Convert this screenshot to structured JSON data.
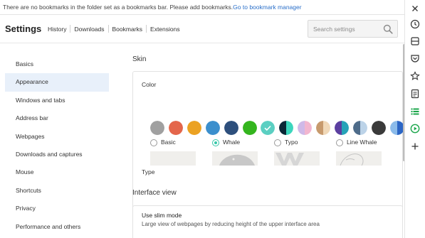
{
  "bookmark_bar": {
    "message": "There are no bookmarks in the folder set as a bookmarks bar. Please add bookmarks.",
    "link": "Go to bookmark manager"
  },
  "header": {
    "title": "Settings",
    "nav": [
      "History",
      "Downloads",
      "Bookmarks",
      "Extensions"
    ],
    "search_placeholder": "Search settings"
  },
  "menu": {
    "items": [
      "Basics",
      "Appearance",
      "Windows and tabs",
      "Address bar",
      "Webpages",
      "Downloads and captures",
      "Mouse",
      "Shortcuts",
      "Privacy",
      "Performance and others"
    ],
    "active": "Appearance"
  },
  "skin": {
    "title": "Skin",
    "color_label": "Color",
    "colors": [
      {
        "a": "#a0a0a0",
        "b": "#a0a0a0"
      },
      {
        "a": "#e4664b",
        "b": "#e4664b"
      },
      {
        "a": "#eba223",
        "b": "#eba223"
      },
      {
        "a": "#3b8fcd",
        "b": "#3b8fcd"
      },
      {
        "a": "#2d4f7c",
        "b": "#2d4f7c"
      },
      {
        "a": "#34b51e",
        "b": "#34b51e"
      },
      {
        "a": "#5bcfc2",
        "b": "#5bcfc2",
        "selected": true
      },
      {
        "a": "#0b2736",
        "b": "#3cd6bd"
      },
      {
        "a": "#cfb9e8",
        "b": "#f2b6cf"
      },
      {
        "a": "#c79a6d",
        "b": "#f0d8b8"
      },
      {
        "a": "#5b3fa0",
        "b": "#27a3b8"
      },
      {
        "a": "#4e6c8a",
        "b": "#bcd3e8"
      },
      {
        "a": "#3a3a3a",
        "b": "#3a3a3a"
      },
      {
        "a": "#8bbbea",
        "b": "#2c66c5"
      }
    ],
    "type_label": "Type",
    "types": [
      {
        "label": "Basic",
        "selected": false
      },
      {
        "label": "Whale",
        "selected": true
      },
      {
        "label": "Typo",
        "selected": false
      },
      {
        "label": "Line Whale",
        "selected": false
      }
    ]
  },
  "interface_view": {
    "title": "Interface view",
    "slim_title": "Use slim mode",
    "slim_desc": "Large view of webpages by reducing height of the upper interface area"
  },
  "sidebar_icons": [
    "close-icon",
    "history-icon",
    "bookmarks-icon",
    "pocket-icon",
    "favorites-icon",
    "notes-icon",
    "list-icon",
    "play-icon",
    "add-icon"
  ],
  "colors": {
    "accent": "#35c7a8",
    "link": "#2a6fc9",
    "menu_active_bg": "#e8f0fa"
  }
}
